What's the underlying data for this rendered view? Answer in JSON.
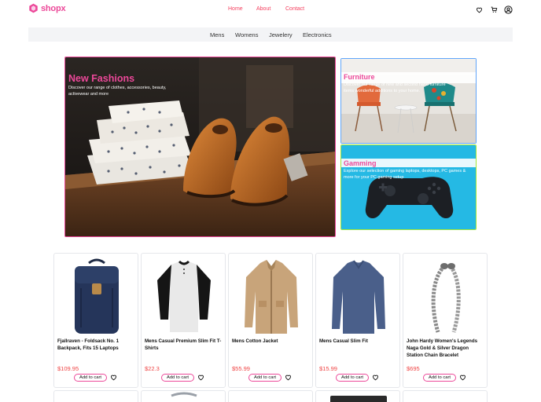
{
  "header": {
    "brand": "shopx",
    "nav": [
      "Home",
      "About",
      "Contact"
    ],
    "icons": [
      "heart-icon",
      "cart-icon",
      "user-icon"
    ]
  },
  "categories": [
    "Mens",
    "Womens",
    "Jewelery",
    "Electronics"
  ],
  "hero": {
    "main": {
      "title": "New Fashions",
      "description": "Discover our range of clothes, accessories, beauty, activewear and more"
    },
    "furniture": {
      "title": "Furniture",
      "description": "Discover our range of new and second hand furniture items wonderful additions to your home."
    },
    "gaming": {
      "title": "Gamming",
      "description": "Explore our selection of gaming laptops, desktops, PC games & more for your PC gaming setup"
    }
  },
  "products": [
    {
      "title": "Fjallraven - Foldsack No. 1 Backpack, Fits 15 Laptops",
      "price": "$109.95",
      "button": "Add to cart"
    },
    {
      "title": "Mens Casual Premium Slim Fit T-Shirts",
      "price": "$22.3",
      "button": "Add to cart"
    },
    {
      "title": "Mens Cotton Jacket",
      "price": "$55.99",
      "button": "Add to cart"
    },
    {
      "title": "Mens Casual Slim Fit",
      "price": "$15.99",
      "button": "Add to cart"
    },
    {
      "title": "John Hardy Women's Legends Naga Gold & Silver Dragon Station Chain Bracelet",
      "price": "$695",
      "button": "Add to cart"
    }
  ],
  "colors": {
    "accent": "#ec4899",
    "price": "#ef4444",
    "nav": "#f43f5e"
  }
}
